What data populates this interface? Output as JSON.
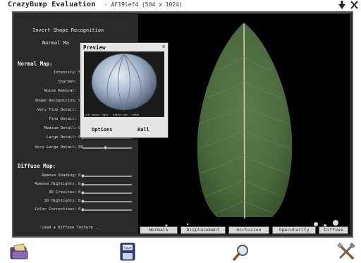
{
  "title_bar": {
    "app_title": "CrazyBump Evaluation",
    "file_info": "- AF19lef4 (504 x 1024)"
  },
  "left_panel": {
    "invert_label": "Invert Shape Recognition",
    "normal_map_button": "Normal Ma",
    "normal_section": "Normal Map:",
    "normal_rows": [
      {
        "label": "Intensity:",
        "value": "5"
      },
      {
        "label": "Sharpen:",
        "value": ""
      },
      {
        "label": "Noise Removal:",
        "value": ""
      },
      {
        "label": "Shape Recognition:",
        "value": "9"
      },
      {
        "label": "Very Fine Detail:",
        "value": ""
      },
      {
        "label": "Fine Detail:",
        "value": ""
      },
      {
        "label": "Medium Detail:",
        "value": "9"
      },
      {
        "label": "Large Detail:",
        "value": "9"
      },
      {
        "label": "Very Large Detail:",
        "value": "50"
      }
    ],
    "diffuse_section": "Diffuse Map:",
    "diffuse_rows": [
      {
        "label": "Remove Shading:",
        "value": "0"
      },
      {
        "label": "Remove Highlights:",
        "value": "0"
      },
      {
        "label": "3D Crevices:",
        "value": "0"
      },
      {
        "label": "3D Highlights:",
        "value": "0"
      },
      {
        "label": "Color Corrections:",
        "value": "0"
      }
    ],
    "load_texture": "Load a Diffuse Texture..."
  },
  "viewport_tabs": [
    "Normals",
    "Displacement",
    "Occlusion",
    "Specularity",
    "Diffuse"
  ],
  "preview": {
    "title": "Preview",
    "close": "x",
    "caption": "Left mouse light · middle pan · wheel",
    "options_label": "Options",
    "ball_label": "Ball"
  },
  "toolbar": {
    "save_label": "Save"
  },
  "colors": {
    "panel_bg": "#2a2a2a",
    "leaf_green": "#4f6a3f",
    "tab_bg": "#d8d8d8"
  }
}
